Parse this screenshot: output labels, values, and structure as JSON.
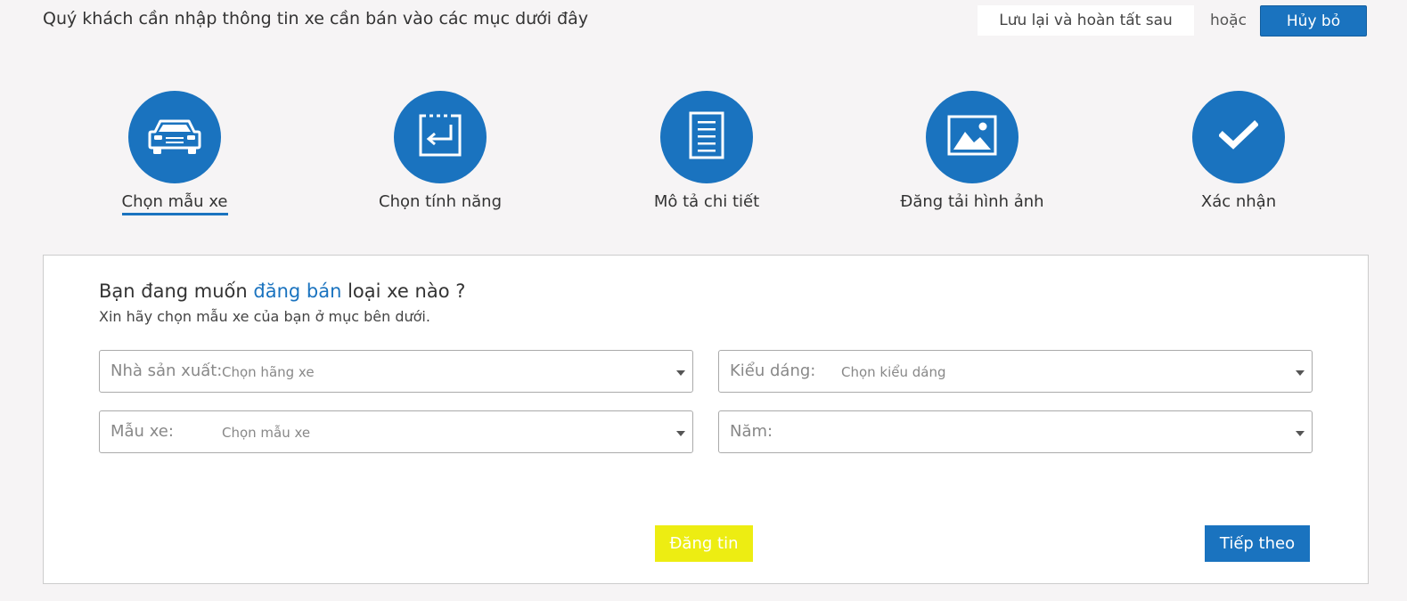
{
  "header": {
    "title": "Quý khách cần nhập thông tin xe cần bán vào các mục dưới đây",
    "save_later_label": "Lưu lại và hoàn tất sau",
    "or_text": "hoặc",
    "cancel_label": "Hủy bỏ"
  },
  "steps": [
    {
      "label": "Chọn mẫu xe",
      "icon": "car-icon",
      "active": true
    },
    {
      "label": "Chọn tính năng",
      "icon": "enter-key-icon",
      "active": false
    },
    {
      "label": "Mô tả chi tiết",
      "icon": "document-icon",
      "active": false
    },
    {
      "label": "Đăng tải hình ảnh",
      "icon": "image-icon",
      "active": false
    },
    {
      "label": "Xác nhận",
      "icon": "checkmark-icon",
      "active": false
    }
  ],
  "form": {
    "title_prefix": "Bạn đang muốn ",
    "title_highlight": "đăng bán",
    "title_suffix": " loại xe nào ?",
    "subtitle": "Xin hãy chọn mẫu xe của bạn ở mục bên dưới.",
    "manufacturer": {
      "label": "Nhà sản xuất:",
      "value": "Chọn hãng xe"
    },
    "body_style": {
      "label": "Kiểu dáng:",
      "value": "Chọn kiểu dáng"
    },
    "model": {
      "label": "Mẫu xe:",
      "value": "Chọn mẫu xe"
    },
    "year": {
      "label": "Năm:",
      "value": ""
    },
    "post_label": "Đăng tin",
    "next_label": "Tiếp theo"
  },
  "colors": {
    "accent": "#1a73bf",
    "post_button": "#eded12",
    "background": "#f6f4f5"
  }
}
